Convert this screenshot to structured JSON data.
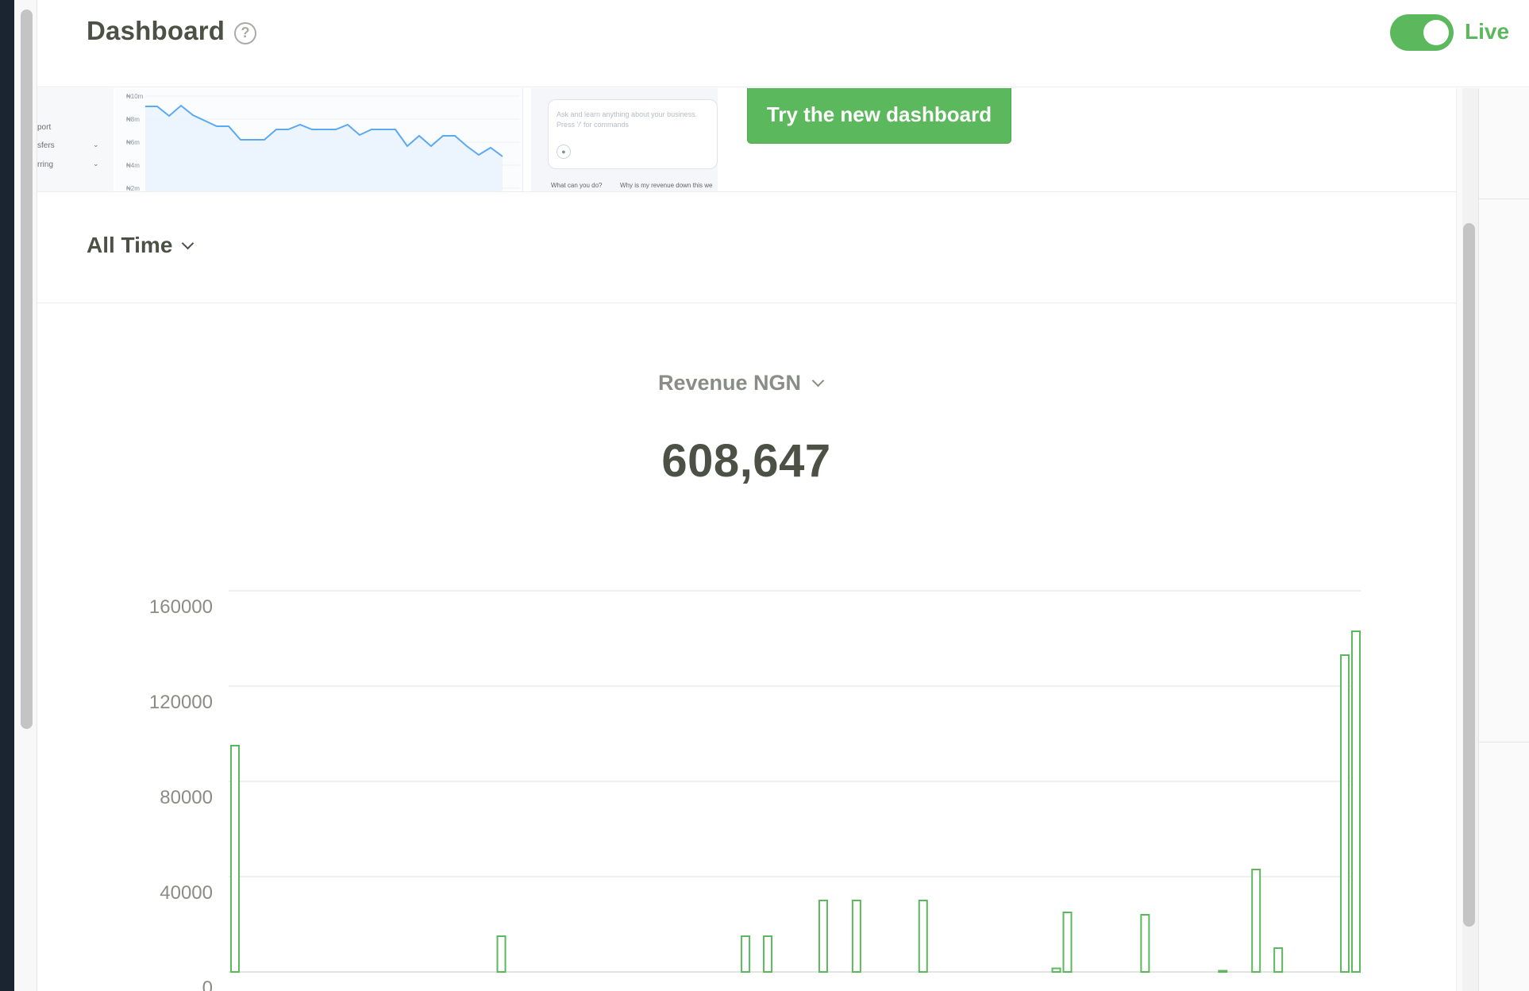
{
  "header": {
    "title": "Dashboard",
    "help_icon": "question-circle-icon",
    "live_toggle": {
      "on": true
    },
    "live_label": "Live"
  },
  "banner": {
    "preview": {
      "sidebar_items": [
        "port",
        "sfers",
        "rring"
      ],
      "chart_y_labels": [
        "₦10m",
        "₦8m",
        "₦6m",
        "₦4m",
        "₦2m"
      ],
      "ai_prompt": "Ask and learn anything about your business. Press '/' for commands",
      "suggestions": [
        "What can you do?",
        "Why is my revenue down this we"
      ]
    },
    "button_label": "Try the new dashboard"
  },
  "filter": {
    "time_range": "All Time"
  },
  "metric": {
    "label": "Revenue NGN",
    "value": "608,647"
  },
  "colors": {
    "accent": "#5cb85c",
    "text": "#4c5045",
    "muted": "#8a8d86"
  },
  "chart_data": {
    "type": "bar",
    "y_ticks": [
      "160000",
      "120000",
      "80000",
      "40000",
      "0"
    ],
    "ylim": [
      0,
      160000
    ],
    "grid": true,
    "values": [
      95000,
      0,
      0,
      0,
      0,
      0,
      0,
      0,
      0,
      0,
      0,
      0,
      0,
      0,
      0,
      0,
      0,
      0,
      0,
      0,
      0,
      0,
      0,
      0,
      15000,
      0,
      0,
      0,
      0,
      0,
      0,
      0,
      0,
      0,
      0,
      0,
      0,
      0,
      0,
      0,
      0,
      0,
      0,
      0,
      0,
      0,
      15000,
      0,
      15000,
      0,
      0,
      0,
      0,
      30000,
      0,
      0,
      30000,
      0,
      0,
      0,
      0,
      0,
      30000,
      0,
      0,
      0,
      0,
      0,
      0,
      0,
      0,
      0,
      0,
      0,
      1500,
      25000,
      0,
      0,
      0,
      0,
      0,
      0,
      24000,
      0,
      0,
      0,
      0,
      0,
      0,
      500,
      0,
      0,
      43000,
      0,
      10000,
      0,
      0,
      0,
      0,
      0,
      133000,
      143000
    ]
  }
}
